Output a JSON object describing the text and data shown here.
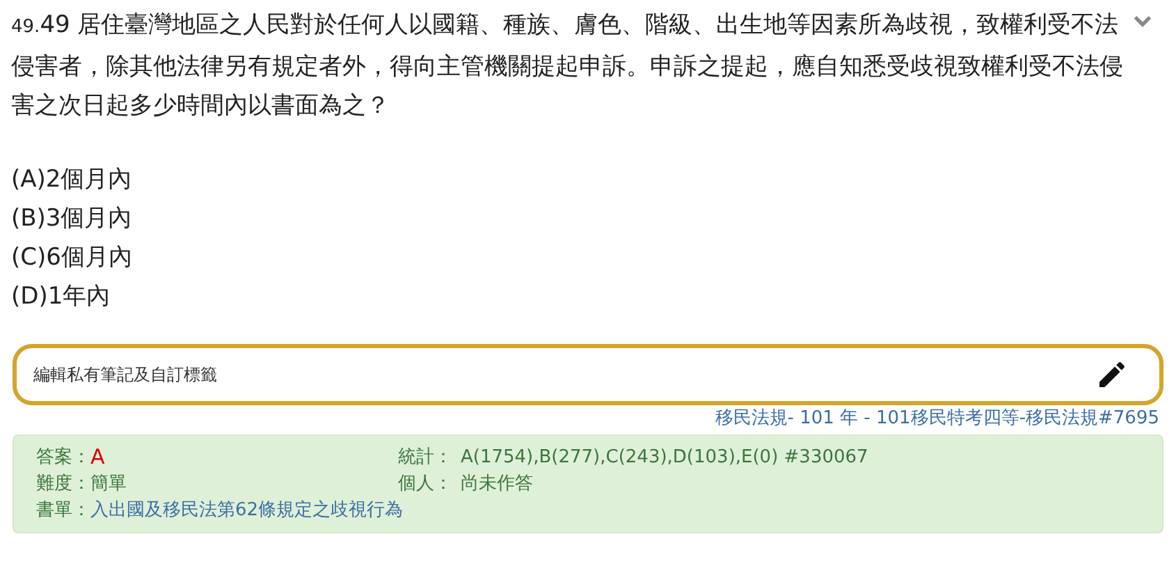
{
  "question": {
    "number": "49.",
    "text": "49 居住臺灣地區之人民對於任何人以國籍、種族、膚色、階級、出生地等因素所為歧視，致權利受不法侵害者，除其他法律另有規定者外，得向主管機關提起申訴。申訴之提起，應自知悉受歧視致權利受不法侵害之次日起多少時間內以書面為之？",
    "expanded": false
  },
  "options": [
    "(A)2個月內",
    "(B)3個月內",
    "(C)6個月內",
    "(D)1年內"
  ],
  "note": {
    "placeholder": "編輯私有筆記及自訂標籤"
  },
  "source": "移民法規- 101 年 - 101移民特考四等-移民法規#7695",
  "info": {
    "answer_label": "答案：",
    "answer": "A",
    "stats_label": "統計：",
    "stats": "A(1754),B(277),C(243),D(103),E(0) #330067",
    "difficulty_label": "難度：",
    "difficulty": "簡單",
    "personal_label": "個人：",
    "personal": "尚未作答",
    "booklist_label": "書單：",
    "booklist": "入出國及移民法第62條規定之歧視行為"
  }
}
